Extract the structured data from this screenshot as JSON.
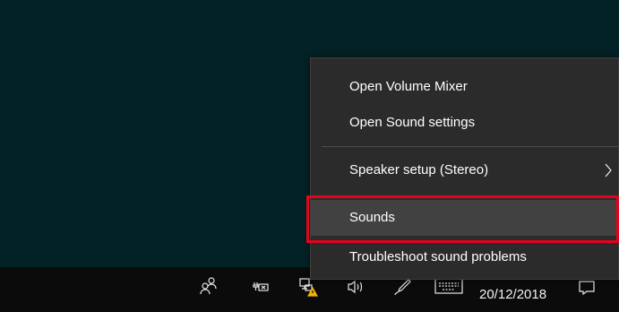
{
  "menu": {
    "items": [
      {
        "label": "Open Volume Mixer"
      },
      {
        "label": "Open Sound settings"
      },
      {
        "label": "Speaker setup (Stereo)",
        "has_submenu": true
      },
      {
        "label": "Sounds",
        "highlighted": true
      },
      {
        "label": "Troubleshoot sound problems"
      }
    ]
  },
  "taskbar": {
    "date": "20/12/2018",
    "icons": [
      "people-icon",
      "battery-icon",
      "network-warning-icon",
      "volume-icon",
      "pen-icon",
      "keyboard-icon",
      "action-center-icon"
    ]
  },
  "colors": {
    "desktop": "#032226",
    "menu_bg": "#2b2b2b",
    "menu_hover": "#414141",
    "annotation": "#e8001c"
  }
}
